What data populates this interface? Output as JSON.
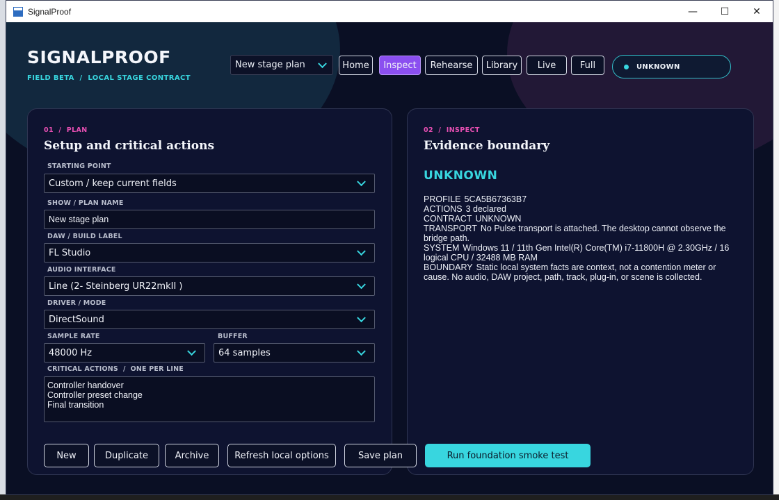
{
  "window": {
    "title": "SignalProof",
    "controls": {
      "minimize": "—",
      "maximize": "☐",
      "close": "✕"
    }
  },
  "header": {
    "brand": "SIGNALPROOF",
    "subtitle": "FIELD BETA  /  LOCAL STAGE CONTRACT",
    "plan_select": "New stage plan",
    "nav": [
      "Home",
      "Inspect",
      "Rehearse",
      "Library",
      "Live",
      "Full"
    ],
    "active_nav": "Inspect",
    "status": "UNKNOWN"
  },
  "plan": {
    "eyebrow": "01  /  PLAN",
    "title": "Setup and critical actions",
    "starting_point": {
      "label": "STARTING POINT",
      "value": "Custom / keep current fields"
    },
    "plan_name": {
      "label": "SHOW / PLAN NAME",
      "value": "New stage plan"
    },
    "daw": {
      "label": "DAW / BUILD LABEL",
      "value": "FL Studio"
    },
    "audio_interface": {
      "label": "AUDIO INTERFACE",
      "value": "Line (2- Steinberg UR22mkII )"
    },
    "driver": {
      "label": "DRIVER / MODE",
      "value": "DirectSound"
    },
    "sample_rate": {
      "label": "SAMPLE RATE",
      "value": "48000 Hz"
    },
    "buffer": {
      "label": "BUFFER",
      "value": "64 samples"
    },
    "critical_actions": {
      "label": "CRITICAL ACTIONS  /  ONE PER LINE",
      "value": "Controller handover\nController preset change\nFinal transition"
    }
  },
  "inspect": {
    "eyebrow": "02  /  INSPECT",
    "title": "Evidence boundary",
    "status": "UNKNOWN",
    "lines": [
      {
        "key": "PROFILE",
        "value": "5CA5B67363B7"
      },
      {
        "key": "ACTIONS",
        "value": "3 declared"
      },
      {
        "key": "CONTRACT",
        "value": "UNKNOWN"
      },
      {
        "key": "TRANSPORT",
        "value": "No Pulse transport is attached. The desktop cannot observe the bridge path."
      },
      {
        "key": "SYSTEM",
        "value": "Windows 11 / 11th Gen Intel(R) Core(TM) i7-11800H @ 2.30GHz / 16 logical CPU / 32488 MB RAM"
      },
      {
        "key": "BOUNDARY",
        "value": "Static local system facts are context, not a contention meter or cause. No audio, DAW project, path, track, plug-in, or scene is collected."
      }
    ]
  },
  "actions": {
    "new": "New",
    "duplicate": "Duplicate",
    "archive": "Archive",
    "refresh": "Refresh local options",
    "save": "Save plan",
    "run": "Run foundation smoke test"
  },
  "colors": {
    "accent": "#38d6df",
    "active_tab": "#8b4ff0",
    "eyebrow": "#e84fb3",
    "background": "#0a0f24"
  }
}
